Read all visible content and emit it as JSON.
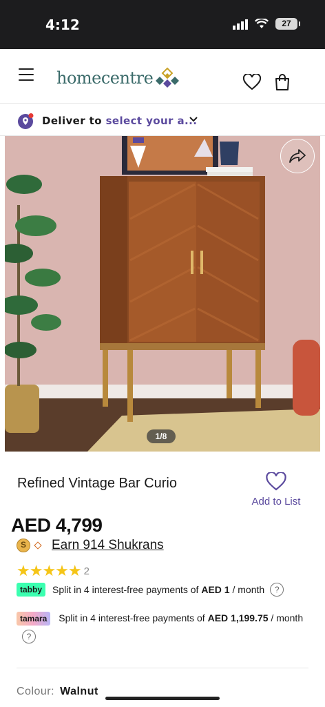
{
  "status_bar": {
    "time": "4:12",
    "battery": "27"
  },
  "header": {
    "logo_text": "homecentre"
  },
  "delivery": {
    "prefix": "Deliver to",
    "link": "select your a..."
  },
  "gallery": {
    "counter": "1/8"
  },
  "product": {
    "title": "Refined Vintage Bar Curio",
    "add_to_list": "Add to List",
    "price": "AED 4,799",
    "shukran": "Earn 914 Shukrans",
    "shukran_coin": "S",
    "rating_stars": "★★★★★",
    "rating_count": "2",
    "rating_value": 5
  },
  "tabby": {
    "badge": "tabby",
    "text": "Split in 4 interest-free payments of",
    "amount": "AED 1",
    "suffix": "/ month",
    "help": "?"
  },
  "tamara": {
    "badge": "tamara",
    "text": "Split in 4 interest-free payments of",
    "amount": "AED 1,199.75",
    "suffix": "/ month",
    "help": "?"
  },
  "colour": {
    "label": "Colour:",
    "value": "Walnut"
  },
  "colors": {
    "brand_teal": "#3b6b6a",
    "accent_purple": "#5b4a9e",
    "star": "#f5c518"
  }
}
